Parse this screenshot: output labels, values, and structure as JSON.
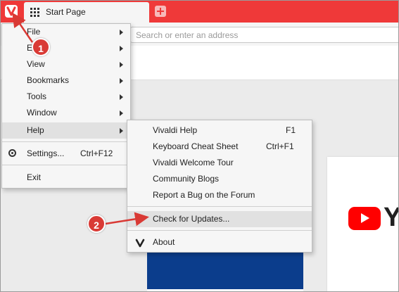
{
  "tab": {
    "title": "Start Page"
  },
  "address_bar": {
    "placeholder": "Search or enter an address"
  },
  "main_menu": {
    "items": [
      {
        "label": "File",
        "has_submenu": true
      },
      {
        "label": "Edit",
        "has_submenu": true
      },
      {
        "label": "View",
        "has_submenu": true
      },
      {
        "label": "Bookmarks",
        "has_submenu": true
      },
      {
        "label": "Tools",
        "has_submenu": true
      },
      {
        "label": "Window",
        "has_submenu": true
      },
      {
        "label": "Help",
        "has_submenu": true,
        "highlighted": true
      }
    ],
    "settings": {
      "label": "Settings...",
      "shortcut": "Ctrl+F12",
      "icon": "gear-icon"
    },
    "exit": {
      "label": "Exit"
    }
  },
  "help_menu": {
    "items": [
      {
        "label": "Vivaldi Help",
        "shortcut": "F1"
      },
      {
        "label": "Keyboard Cheat Sheet",
        "shortcut": "Ctrl+F1"
      },
      {
        "label": "Vivaldi Welcome Tour",
        "shortcut": ""
      },
      {
        "label": "Community Blogs",
        "shortcut": ""
      },
      {
        "label": "Report a Bug on the Forum",
        "shortcut": ""
      }
    ],
    "check_updates": {
      "label": "Check for Updates...",
      "highlighted": true
    },
    "about": {
      "label": "About",
      "icon": "vivaldi-logo-icon"
    }
  },
  "annotations": [
    {
      "number": "1"
    },
    {
      "number": "2"
    }
  ],
  "speed_dial": {
    "youtube_partial_text": "Y"
  },
  "colors": {
    "tab_bar": "#ef3939",
    "menu_highlight": "#e1e1e1",
    "annotation": "#d93a35",
    "youtube_red": "#ff0000"
  }
}
